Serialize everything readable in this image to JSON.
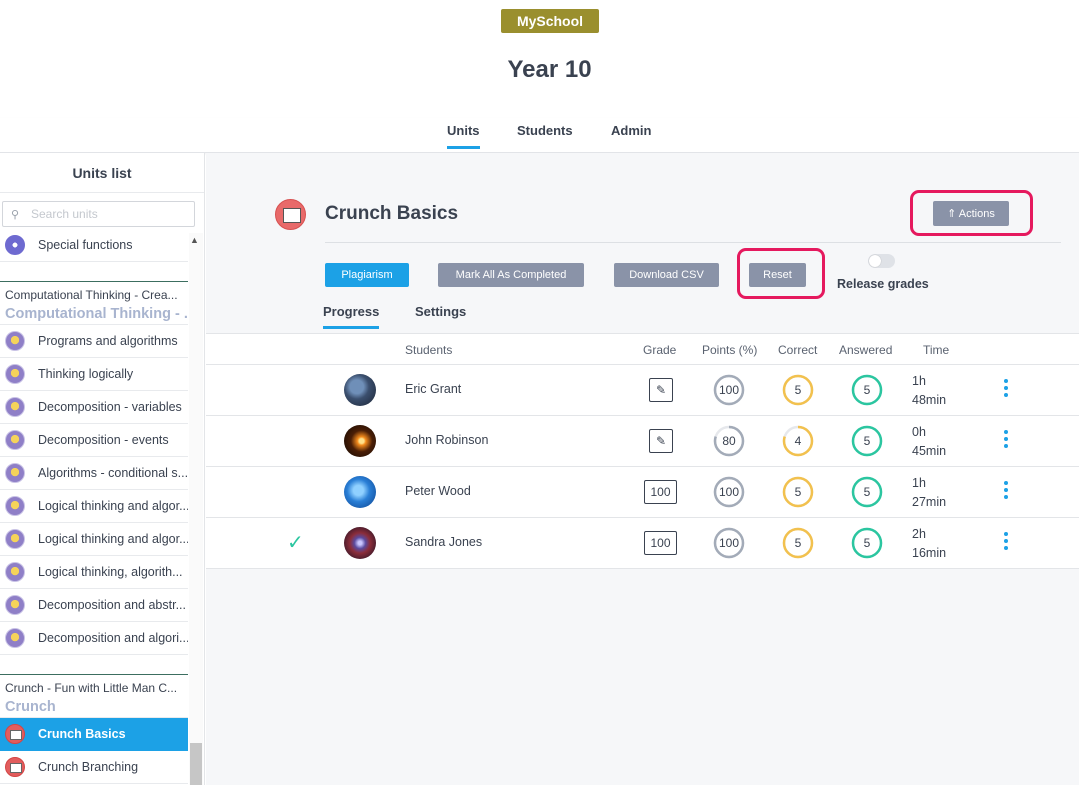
{
  "header": {
    "brand": "MySchool",
    "title": "Year 10"
  },
  "topnav": {
    "tabs": [
      "Units",
      "Students",
      "Admin"
    ],
    "active": "Units"
  },
  "sidebar": {
    "title": "Units list",
    "search_placeholder": "Search units",
    "items_top": [
      {
        "label": "Special functions",
        "icon": "special-icon"
      }
    ],
    "group1": {
      "head": "Computational Thinking - Crea...",
      "sub": "Computational Thinking - ...",
      "items": [
        "Programs and algorithms",
        "Thinking logically",
        "Decomposition - variables",
        "Decomposition - events",
        "Algorithms - conditional s...",
        "Logical thinking and algor...",
        "Logical thinking and algor...",
        "Logical thinking, algorith...",
        "Decomposition and abstr...",
        "Decomposition and algori..."
      ]
    },
    "group2": {
      "head": "Crunch - Fun with Little Man C...",
      "sub": "Crunch",
      "items": [
        "Crunch Basics",
        "Crunch Branching"
      ],
      "active": "Crunch Basics"
    }
  },
  "main": {
    "unit_title": "Crunch Basics",
    "actions_label": "⇑ Actions",
    "buttons": {
      "plagiarism": "Plagiarism",
      "mark_all": "Mark All As Completed",
      "download_csv": "Download CSV",
      "reset": "Reset"
    },
    "release_grades_label": "Release grades",
    "release_grades_on": false,
    "subtabs": [
      "Progress",
      "Settings"
    ],
    "active_subtab": "Progress",
    "columns": [
      "Students",
      "Grade",
      "Points (%)",
      "Correct",
      "Answered",
      "Time"
    ],
    "rows": [
      {
        "name": "Eric Grant",
        "grade": "",
        "grade_icon": "pencil-icon",
        "points": "100",
        "points_frac": 1.0,
        "correct": "5",
        "correct_frac": 1.0,
        "answered": "5",
        "time_h": "1h",
        "time_m": "48min",
        "checked": false,
        "avatar": "earth"
      },
      {
        "name": "John Robinson",
        "grade": "",
        "grade_icon": "pencil-icon",
        "points": "80",
        "points_frac": 0.8,
        "correct": "4",
        "correct_frac": 0.8,
        "answered": "5",
        "time_h": "0h",
        "time_m": "45min",
        "checked": false,
        "avatar": "eclipse"
      },
      {
        "name": "Peter Wood",
        "grade": "100",
        "grade_icon": "",
        "points": "100",
        "points_frac": 1.0,
        "correct": "5",
        "correct_frac": 1.0,
        "answered": "5",
        "time_h": "1h",
        "time_m": "27min",
        "checked": false,
        "avatar": "globe"
      },
      {
        "name": "Sandra Jones",
        "grade": "100",
        "grade_icon": "",
        "points": "100",
        "points_frac": 1.0,
        "correct": "5",
        "correct_frac": 1.0,
        "answered": "5",
        "time_h": "2h",
        "time_m": "16min",
        "checked": true,
        "avatar": "space"
      }
    ],
    "colors": {
      "accent": "#1ca1e6",
      "points": "#a3abb8",
      "correct": "#f2c14e",
      "answered": "#2bc6a0",
      "highlight": "#e5195e"
    }
  }
}
